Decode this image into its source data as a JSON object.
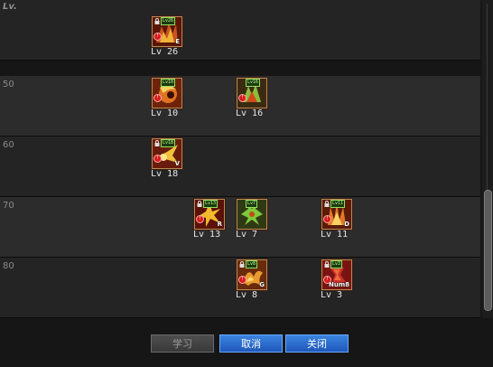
{
  "header": {
    "label": "Lv."
  },
  "rows": [
    {
      "label": "",
      "skills": [
        {
          "level_text": "Lv 26",
          "badge": "Lv26",
          "key": "E",
          "warning": "!",
          "locked": true
        }
      ]
    },
    {
      "label": "50",
      "skills": [
        {
          "level_text": "Lv 10",
          "badge": "Lv10",
          "key": "",
          "warning": "!",
          "locked": false
        },
        {
          "level_text": "Lv 16",
          "badge": "Lv16",
          "key": "",
          "warning": "!",
          "locked": false
        }
      ]
    },
    {
      "label": "60",
      "skills": [
        {
          "level_text": "Lv 18",
          "badge": "Lv18",
          "key": "V",
          "warning": "!",
          "locked": true
        }
      ]
    },
    {
      "label": "70",
      "skills": [
        {
          "level_text": "Lv 13",
          "badge": "Lv13",
          "key": "R",
          "warning": "!",
          "locked": true
        },
        {
          "level_text": "Lv 7",
          "badge": "Lv7",
          "key": "",
          "warning": "",
          "locked": false
        },
        {
          "level_text": "Lv 11",
          "badge": "Lv11",
          "key": "D",
          "warning": "!",
          "locked": true
        }
      ]
    },
    {
      "label": "80",
      "skills": [
        {
          "level_text": "Lv 8",
          "badge": "Lv8",
          "key": "G",
          "warning": "!",
          "locked": true
        },
        {
          "level_text": "Lv 3",
          "badge": "Lv3",
          "key": "Num8",
          "warning": "!",
          "locked": true
        }
      ]
    }
  ],
  "buttons": {
    "learn": "学习",
    "cancel": "取消",
    "close": "关闭"
  },
  "colors": {
    "accent_blue": "#2e6fd0",
    "badge_green": "#8fe05b",
    "icon_border": "#b88a55",
    "warning_red": "#d61b1b"
  },
  "icons": [
    "skill-fire-icon",
    "skill-claw-icon",
    "skill-burst-icon",
    "skill-thorn-icon",
    "skill-rune-icon",
    "lock-icon"
  ]
}
